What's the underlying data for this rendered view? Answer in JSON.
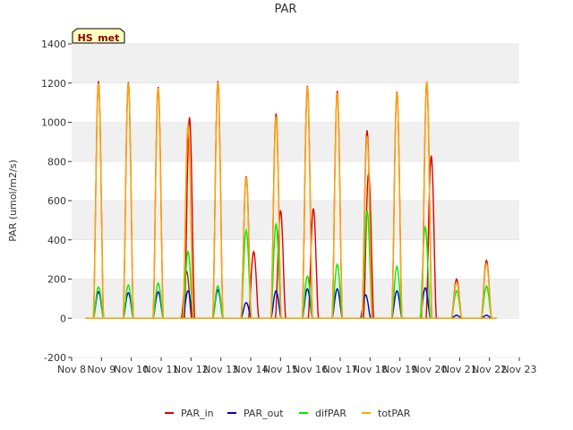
{
  "chart_data": {
    "type": "line",
    "title": "PAR",
    "xlabel": "",
    "ylabel": "PAR (umol/m2/s)",
    "badge": "HS_met",
    "x_ticks": [
      "Nov 8",
      "Nov 9",
      "Nov 10",
      "Nov 11",
      "Nov 12",
      "Nov 13",
      "Nov 14",
      "Nov 15",
      "Nov 16",
      "Nov 17",
      "Nov 18",
      "Nov 19",
      "Nov 20",
      "Nov 21",
      "Nov 22",
      "Nov 23"
    ],
    "xlim": [
      8,
      23
    ],
    "ylim": [
      -200,
      1400
    ],
    "y_ticks": [
      -200,
      0,
      200,
      400,
      600,
      800,
      1000,
      1200,
      1400
    ],
    "grid": true,
    "legend_position": "bottom-center",
    "colors": {
      "panel_bg": "#f0f0f0",
      "band_bg": "#ffffff",
      "grid": "#ffffff",
      "badge_fill": "#ffffc0"
    },
    "series": [
      {
        "name": "PAR_in",
        "color": "#dd0000",
        "peaks": [
          [
            8.9,
            1210
          ],
          [
            9.9,
            1205
          ],
          [
            10.9,
            1180
          ],
          [
            11.85,
            240
          ],
          [
            11.95,
            1025
          ],
          [
            12.9,
            1210
          ],
          [
            13.85,
            725
          ],
          [
            14.1,
            340
          ],
          [
            14.85,
            1045
          ],
          [
            15.0,
            550
          ],
          [
            15.9,
            1185
          ],
          [
            16.1,
            560
          ],
          [
            16.9,
            1160
          ],
          [
            17.9,
            960
          ],
          [
            17.95,
            740
          ],
          [
            18.9,
            1155
          ],
          [
            19.9,
            1205
          ],
          [
            20.05,
            830
          ],
          [
            20.9,
            200
          ],
          [
            21.9,
            295
          ]
        ]
      },
      {
        "name": "PAR_out",
        "color": "#0000cc",
        "peaks": [
          [
            8.9,
            135
          ],
          [
            9.9,
            130
          ],
          [
            10.9,
            135
          ],
          [
            11.9,
            140
          ],
          [
            12.9,
            145
          ],
          [
            13.85,
            80
          ],
          [
            14.85,
            140
          ],
          [
            15.9,
            150
          ],
          [
            16.9,
            150
          ],
          [
            17.85,
            120
          ],
          [
            18.9,
            140
          ],
          [
            19.85,
            155
          ],
          [
            20.9,
            15
          ],
          [
            21.9,
            15
          ]
        ]
      },
      {
        "name": "difPAR",
        "color": "#00ee00",
        "peaks": [
          [
            8.9,
            160
          ],
          [
            9.9,
            170
          ],
          [
            10.9,
            180
          ],
          [
            11.9,
            340
          ],
          [
            12.9,
            165
          ],
          [
            13.85,
            450
          ],
          [
            14.85,
            480
          ],
          [
            15.9,
            215
          ],
          [
            16.9,
            275
          ],
          [
            17.9,
            550
          ],
          [
            18.9,
            265
          ],
          [
            19.85,
            465
          ],
          [
            20.9,
            140
          ],
          [
            21.9,
            165
          ]
        ]
      },
      {
        "name": "totPAR",
        "color": "#ffa500",
        "peaks": [
          [
            8.9,
            1200
          ],
          [
            9.9,
            1200
          ],
          [
            10.9,
            1175
          ],
          [
            11.9,
            990
          ],
          [
            12.9,
            1205
          ],
          [
            13.85,
            720
          ],
          [
            14.85,
            1030
          ],
          [
            15.9,
            1180
          ],
          [
            16.9,
            1150
          ],
          [
            17.9,
            930
          ],
          [
            18.9,
            1150
          ],
          [
            19.9,
            1210
          ],
          [
            20.9,
            185
          ],
          [
            21.9,
            280
          ]
        ]
      }
    ]
  }
}
